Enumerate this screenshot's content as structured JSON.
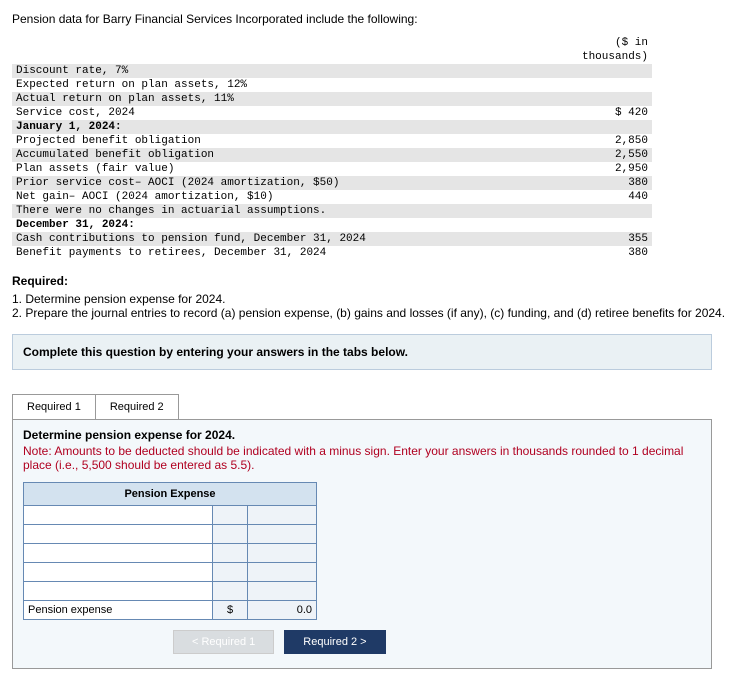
{
  "intro": "Pension data for Barry Financial Services Incorporated include the following:",
  "unitsHeader": "($ in thousands)",
  "dataRows": [
    {
      "label": "Discount rate, 7%",
      "value": "",
      "shade": true
    },
    {
      "label": "Expected return on plan assets, 12%",
      "value": "",
      "shade": false
    },
    {
      "label": "Actual return on plan assets, 11%",
      "value": "",
      "shade": true
    },
    {
      "label": "Service cost, 2024",
      "value": "$ 420",
      "shade": false
    },
    {
      "label": "January 1, 2024:",
      "value": "",
      "shade": true,
      "bold": true
    },
    {
      "label": "Projected benefit obligation",
      "value": "2,850",
      "shade": false
    },
    {
      "label": "Accumulated benefit obligation",
      "value": "2,550",
      "shade": true
    },
    {
      "label": "Plan assets (fair value)",
      "value": "2,950",
      "shade": false
    },
    {
      "label": "Prior service cost– AOCI (2024 amortization, $50)",
      "value": "380",
      "shade": true
    },
    {
      "label": "Net gain– AOCI (2024 amortization, $10)",
      "value": "440",
      "shade": false
    },
    {
      "label": "There were no changes in actuarial assumptions.",
      "value": "",
      "shade": true
    },
    {
      "label": "December 31, 2024:",
      "value": "",
      "shade": false,
      "bold": true
    },
    {
      "label": "Cash contributions to pension fund, December 31, 2024",
      "value": "355",
      "shade": true
    },
    {
      "label": "Benefit payments to retirees, December 31, 2024",
      "value": "380",
      "shade": false
    }
  ],
  "requiredHeading": "Required:",
  "requiredItems": [
    "1. Determine pension expense for 2024.",
    "2. Prepare the journal entries to record (a) pension expense, (b) gains and losses (if any), (c) funding, and (d) retiree benefits for 2024."
  ],
  "promptBox": "Complete this question by entering your answers in the tabs below.",
  "tabs": {
    "t1": "Required 1",
    "t2": "Required 2"
  },
  "panel": {
    "title": "Determine pension expense for 2024.",
    "note": "Note: Amounts to be deducted should be indicated with a minus sign. Enter your answers in thousands rounded to 1 decimal place (i.e., 5,500 should be entered as 5.5).",
    "gridHeader": "Pension Expense",
    "totalLabel": "Pension expense",
    "dollarSign": "$",
    "totalValue": "0.0"
  },
  "nav": {
    "prev": "<  Required 1",
    "next": "Required 2  >"
  }
}
